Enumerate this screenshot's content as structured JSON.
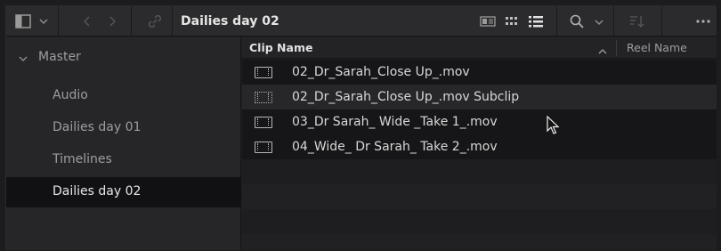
{
  "toolbar": {
    "title": "Dailies day 02",
    "icons": [
      "sidebar-toggle-icon",
      "chevron-down-icon",
      "back-arrow-icon",
      "forward-arrow-icon",
      "link-icon",
      "metadata-view-icon",
      "thumbnail-view-icon",
      "list-view-icon",
      "search-icon",
      "chevron-down-icon",
      "sort-icon",
      "more-icon"
    ]
  },
  "sidebar": {
    "root_label": "Master",
    "items": [
      {
        "label": "Audio"
      },
      {
        "label": "Dailies day 01"
      },
      {
        "label": "Timelines"
      },
      {
        "label": "Dailies day 02",
        "selected": true
      }
    ]
  },
  "list": {
    "columns": {
      "clip_name": "Clip Name",
      "reel_name": "Reel Name"
    },
    "rows": [
      {
        "name": "02_Dr_Sarah_Close Up_.mov",
        "type": "clip"
      },
      {
        "name": "02_Dr_Sarah_Close Up_.mov Subclip",
        "type": "subclip"
      },
      {
        "name": "03_Dr Sarah_ Wide _Take 1_.mov",
        "type": "clip"
      },
      {
        "name": "04_Wide_ Dr Sarah_ Take 2_.mov",
        "type": "clip"
      }
    ]
  },
  "colors": {
    "toolbar_bg": "#2b2b2d",
    "sidebar_bg": "#262628",
    "selected_bg": "#111113",
    "list_bg": "#1d1d1f"
  }
}
